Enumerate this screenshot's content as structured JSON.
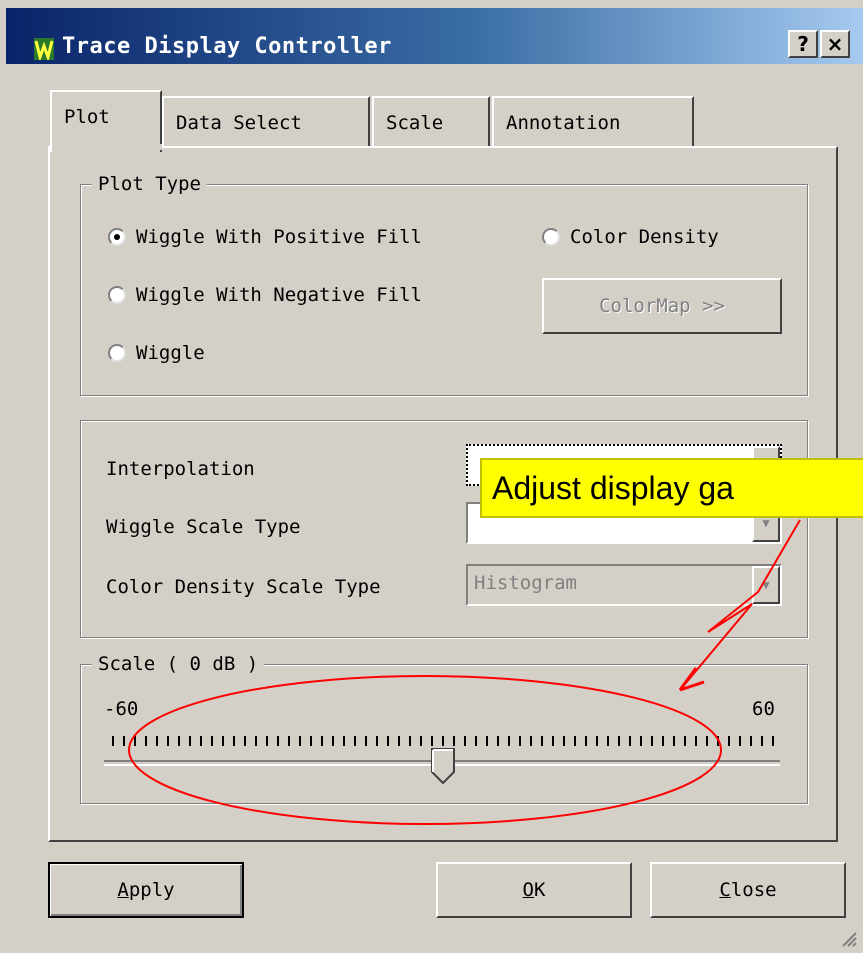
{
  "window": {
    "title": "Trace Display Controller",
    "help_label": "?",
    "close_label": "×"
  },
  "tabs": [
    {
      "label": "Plot",
      "active": true
    },
    {
      "label": "Data Select",
      "active": false
    },
    {
      "label": "Scale",
      "active": false
    },
    {
      "label": "Annotation",
      "active": false
    }
  ],
  "plot_type": {
    "legend": "Plot Type",
    "options": [
      {
        "label": "Wiggle With Positive Fill",
        "selected": true
      },
      {
        "label": "Wiggle With Negative Fill",
        "selected": false
      },
      {
        "label": "Wiggle",
        "selected": false
      },
      {
        "label": "Color Density",
        "selected": false
      }
    ],
    "colormap_button": "ColorMap >>"
  },
  "settings": {
    "interpolation_label": "Interpolation",
    "interpolation_value": "",
    "wiggle_scale_label": "Wiggle Scale Type",
    "wiggle_scale_value": "",
    "color_density_label": "Color Density Scale Type",
    "color_density_value": "Histogram"
  },
  "scale": {
    "legend": "Scale ( 0 dB )",
    "min_label": "-60",
    "max_label": "60",
    "min": -60,
    "max": 60,
    "value": 0
  },
  "buttons": {
    "apply": {
      "prefix": "",
      "mnemonic": "A",
      "rest": "pply"
    },
    "ok": {
      "prefix": "",
      "mnemonic": "O",
      "rest": "K"
    },
    "close": {
      "prefix": "",
      "mnemonic": "C",
      "rest": "lose"
    }
  },
  "annotation": {
    "callout_text": "Adjust display ga",
    "color": "#ff0000",
    "callout_bg": "#ffff00"
  }
}
